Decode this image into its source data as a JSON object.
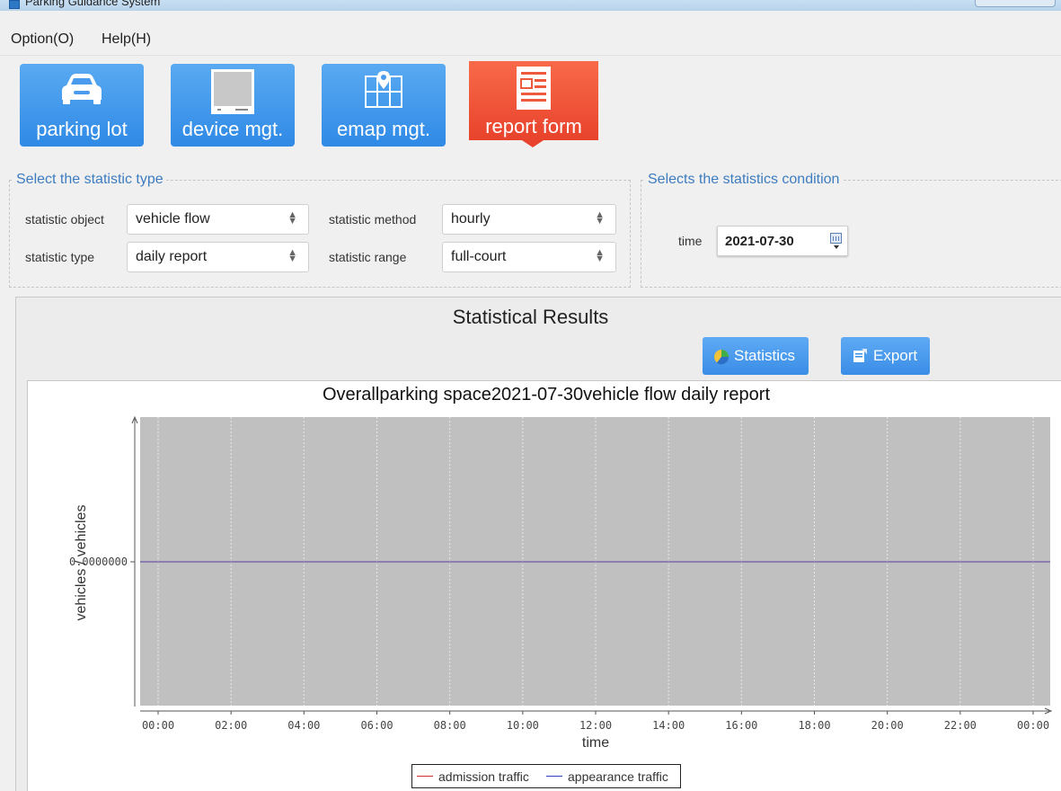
{
  "window": {
    "title": "Parking Guidance System"
  },
  "menu": {
    "items": [
      "Option(O)",
      "Help(H)"
    ]
  },
  "modules": [
    {
      "label": "parking lot",
      "icon": "car-icon",
      "active": false
    },
    {
      "label": "device mgt.",
      "icon": "monitor-icon",
      "active": false
    },
    {
      "label": "emap mgt.",
      "icon": "map-pin-icon",
      "active": false
    },
    {
      "label": "report form",
      "icon": "report-icon",
      "active": true
    }
  ],
  "statistic_type_panel": {
    "title": "Select the statistic type",
    "statistic_object": {
      "label": "statistic object",
      "value": "vehicle flow"
    },
    "statistic_method": {
      "label": "statistic method",
      "value": "hourly"
    },
    "statistic_type": {
      "label": "statistic type",
      "value": "daily report"
    },
    "statistic_range": {
      "label": "statistic range",
      "value": "full-court"
    }
  },
  "condition_panel": {
    "title": "Selects the statistics condition",
    "time_label": "time",
    "time_value": "2021-07-30"
  },
  "results": {
    "title": "Statistical Results",
    "statistics_button": "Statistics",
    "export_button": "Export"
  },
  "colors": {
    "accent_blue": "#2f8ae6",
    "active_red": "#e8432c",
    "plot_background": "#c0c0c0",
    "admission_line": "#d03030",
    "appearance_line": "#3040c0"
  },
  "chart_data": {
    "type": "line",
    "title": "Overallparking space2021-07-30vehicle flow daily report",
    "xlabel": "time",
    "ylabel": "vehicles / vehicles",
    "x_ticks": [
      "00:00",
      "02:00",
      "04:00",
      "06:00",
      "08:00",
      "10:00",
      "12:00",
      "14:00",
      "16:00",
      "18:00",
      "20:00",
      "22:00",
      "00:00"
    ],
    "y_ticks": [
      "0.0000000"
    ],
    "x_hours": [
      0,
      24
    ],
    "series": [
      {
        "name": "admission traffic",
        "x": [
          0,
          24
        ],
        "values": [
          0,
          0
        ]
      },
      {
        "name": "appearance traffic",
        "x": [
          0,
          24
        ],
        "values": [
          0,
          0
        ]
      }
    ],
    "grid": true,
    "legend_position": "bottom"
  }
}
